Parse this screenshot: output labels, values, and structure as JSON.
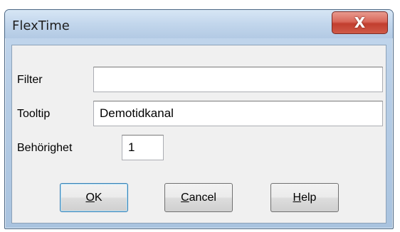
{
  "window": {
    "title": "FlexTime",
    "close_glyph": "X"
  },
  "form": {
    "filter_label": "Filter",
    "filter_value": "",
    "tooltip_label": "Tooltip",
    "tooltip_value": "Demotidkanal",
    "permission_label": "Behörighet",
    "permission_value": "1"
  },
  "buttons": {
    "ok": {
      "mnemonic": "O",
      "rest": "K"
    },
    "cancel": {
      "mnemonic": "C",
      "rest": "ancel"
    },
    "help": {
      "mnemonic": "H",
      "rest": "elp"
    }
  },
  "colors": {
    "title_bar": "#c2d6ec",
    "close_button": "#c23e2e",
    "client_bg": "#f0f0f0"
  },
  "icons": {
    "close": "close-icon"
  }
}
